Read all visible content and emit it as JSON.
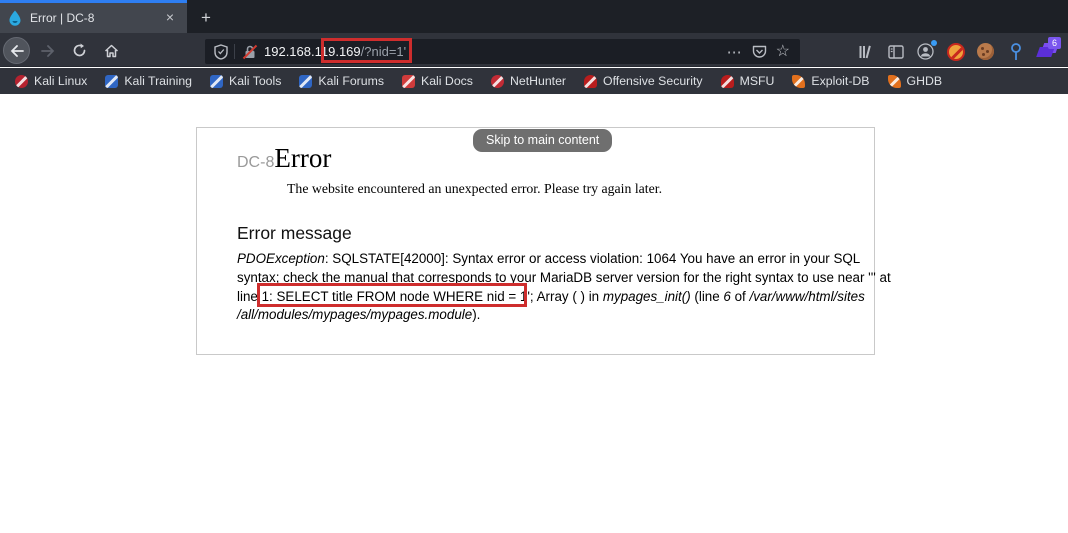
{
  "tab": {
    "title": "Error | DC-8",
    "favicon": "drupal-drop"
  },
  "icons": {
    "close_tab": "×",
    "new_tab": "+",
    "page_actions": "⋯",
    "bookmark_star": "☆"
  },
  "urlbar": {
    "domain": "192.168.119.169",
    "path": "/?nid=1'"
  },
  "extensions": {
    "hacktools_badge": "6"
  },
  "bookmarks": {
    "items": [
      {
        "label": "Kali Linux",
        "color": "#b5222f",
        "shape": "circle"
      },
      {
        "label": "Kali Training",
        "color": "#2f66c4",
        "shape": "square"
      },
      {
        "label": "Kali Tools",
        "color": "#2f66c4",
        "shape": "square"
      },
      {
        "label": "Kali Forums",
        "color": "#2f66c4",
        "shape": "square"
      },
      {
        "label": "Kali Docs",
        "color": "#cf3b3b",
        "shape": "square"
      },
      {
        "label": "NetHunter",
        "color": "#c22b35",
        "shape": "circle"
      },
      {
        "label": "Offensive Security",
        "color": "#b91d1d",
        "shape": "pawn"
      },
      {
        "label": "MSFU",
        "color": "#b91d1d",
        "shape": "pawn"
      },
      {
        "label": "Exploit-DB",
        "color": "#e2701d",
        "shape": "bird"
      },
      {
        "label": "GHDB",
        "color": "#e2701d",
        "shape": "bird"
      }
    ]
  },
  "page": {
    "skip_link": "Skip to main content",
    "site_name": "DC-8",
    "title": "Error",
    "intro": "The website encountered an unexpected error. Please try again later.",
    "section_heading": "Error message",
    "error": {
      "l1_italic": "PDOException",
      "l1_rest": ": SQLSTATE[42000]: Syntax error or access violation: 1064 You have an error in your SQL",
      "l2": "syntax; check the manual that corresponds to your MariaDB server version for the right syntax to use near ''' at",
      "l3_a": "line 1: SELECT title FROM node WHERE nid = 1'; Array ( ) in ",
      "l3_b_italic": "mypages_init()",
      "l3_c": " (line ",
      "l3_d_italic": "6",
      "l3_e": " of ",
      "l3_f_italic": "/var/www/html/sites",
      "l4_italic": "/all/modules/mypages/mypages.module",
      "l4_rest": ")."
    }
  },
  "colors": {
    "accent_blue": "#2e7ef2",
    "annotation_red": "#ce2d2d",
    "insecure_red": "#d13a30",
    "drupal_blue": "#2ba9e0",
    "extension_purple": "#5b2fd8"
  }
}
